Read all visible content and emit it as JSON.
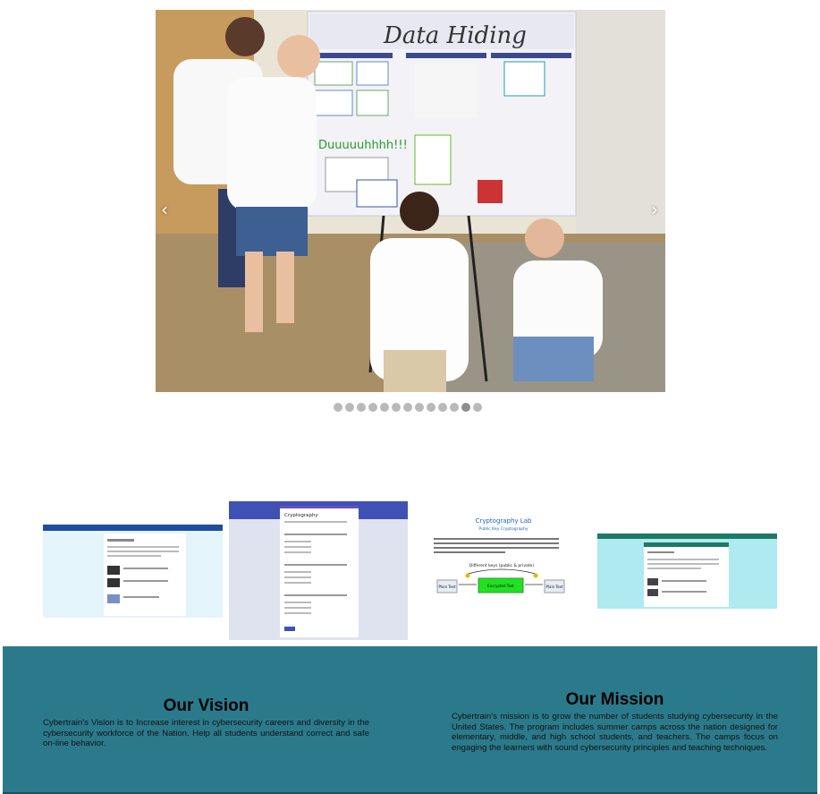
{
  "carousel": {
    "prev_symbol": "‹",
    "next_symbol": "›",
    "slide_count": 13,
    "active_index": 11,
    "poster_title": "Data Hiding",
    "poster_sign": "Duuuuuhhhh!!!"
  },
  "thumbnails": {
    "cryptography_quiz_title": "Cryptography",
    "lab_title": "Cryptography Lab",
    "lab_subtitle": "Public Key Cryptography",
    "lab_keys_label": "Different keys (public & private)",
    "lab_plain_left": "Plain Text",
    "lab_encrypted": "Encrypted Text",
    "lab_plain_right": "Plain Text"
  },
  "vision": {
    "title": "Our Vision",
    "body": "Cybertrain's Vision is to Increase interest in cybersecurity careers and diversity in the cybersecurity workforce of the Nation. Help all students understand correct and safe on-line behavior."
  },
  "mission": {
    "title": "Our Mission",
    "body": "Cybertrain's mission is to grow the number of students studying cybersecurity in the United States. The program includes summer camps across the nation designed for elementary, middle, and high school students, and teachers. The camps focus on engaging the learners with sound cybersecurity principles and teaching techniques."
  },
  "colors": {
    "band": "#2b7a8c",
    "dot": "#b9b9b9",
    "lab_green": "#22e022",
    "lab_blue": "#1f63c6"
  }
}
